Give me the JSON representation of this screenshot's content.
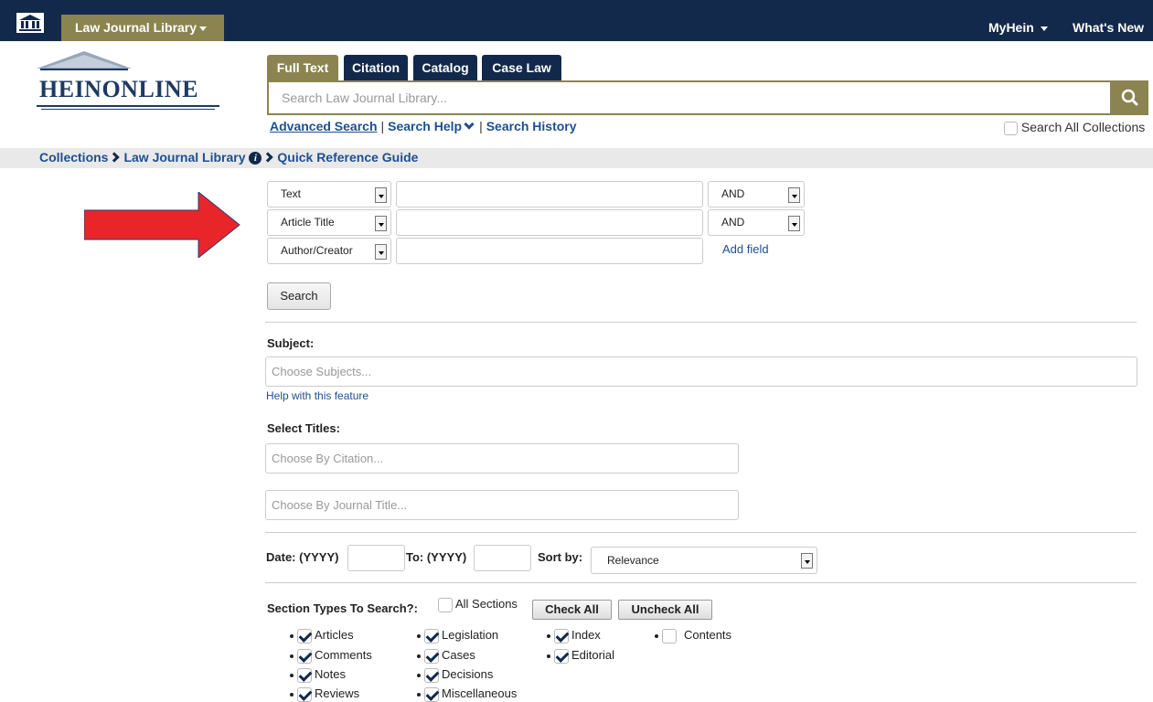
{
  "topbar": {
    "library_menu": "Law Journal Library",
    "myhein": "MyHein",
    "whats_new": "What's New"
  },
  "logo": {
    "text": "HEINONLINE"
  },
  "tabs": [
    {
      "label": "Full Text",
      "active": true
    },
    {
      "label": "Citation",
      "active": false
    },
    {
      "label": "Catalog",
      "active": false
    },
    {
      "label": "Case Law",
      "active": false
    }
  ],
  "search": {
    "placeholder": "Search Law Journal Library...",
    "advanced": "Advanced Search",
    "help": "Search Help",
    "history": "Search History",
    "all_collections": "Search All Collections"
  },
  "breadcrumb": {
    "collections": "Collections",
    "library": "Law Journal Library",
    "guide": "Quick Reference Guide"
  },
  "fields": [
    {
      "field": "Text",
      "operator": "AND"
    },
    {
      "field": "Article Title",
      "operator": "AND"
    },
    {
      "field": "Author/Creator",
      "operator": ""
    }
  ],
  "add_field": "Add field",
  "search_button": "Search",
  "subject": {
    "label": "Subject:",
    "placeholder": "Choose Subjects...",
    "help": "Help with this feature"
  },
  "titles": {
    "label": "Select Titles:",
    "citation_placeholder": "Choose By Citation...",
    "journal_placeholder": "Choose By Journal Title..."
  },
  "date": {
    "from_label": "Date: (YYYY)",
    "to_label": "To: (YYYY)",
    "sort_label": "Sort by:",
    "sort_value": "Relevance"
  },
  "sections": {
    "label": "Section Types To Search?:",
    "all_label": "All Sections",
    "check_all": "Check All",
    "uncheck_all": "Uncheck All",
    "items": [
      {
        "label": "Articles",
        "checked": true
      },
      {
        "label": "Comments",
        "checked": true
      },
      {
        "label": "Notes",
        "checked": true
      },
      {
        "label": "Reviews",
        "checked": true
      },
      {
        "label": "Legislation",
        "checked": true
      },
      {
        "label": "Cases",
        "checked": true
      },
      {
        "label": "Decisions",
        "checked": true
      },
      {
        "label": "Miscellaneous",
        "checked": true
      },
      {
        "label": "Index",
        "checked": true
      },
      {
        "label": "Editorial",
        "checked": true
      },
      {
        "label": "Contents",
        "checked": false
      }
    ]
  },
  "colors": {
    "navy": "#13294b",
    "gold": "#8b8450",
    "link": "#1d4f91",
    "arrow": "#e8262a"
  }
}
